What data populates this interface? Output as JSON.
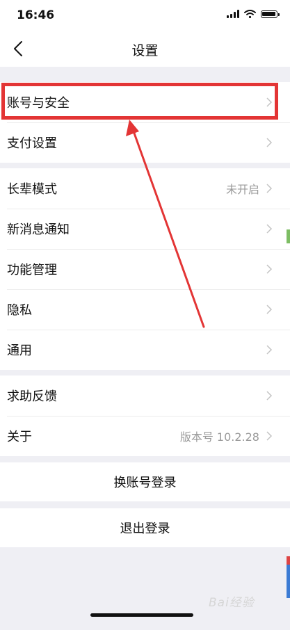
{
  "status_bar": {
    "time": "16:46"
  },
  "nav": {
    "title": "设置",
    "back_icon": "chevron-left-icon"
  },
  "groups": [
    {
      "items": [
        {
          "label": "账号与安全",
          "value": ""
        },
        {
          "label": "支付设置",
          "value": ""
        }
      ]
    },
    {
      "items": [
        {
          "label": "长辈模式",
          "value": "未开启"
        },
        {
          "label": "新消息通知",
          "value": ""
        },
        {
          "label": "功能管理",
          "value": ""
        },
        {
          "label": "隐私",
          "value": ""
        },
        {
          "label": "通用",
          "value": ""
        }
      ]
    },
    {
      "items": [
        {
          "label": "求助反馈",
          "value": ""
        },
        {
          "label": "关于",
          "value": "版本号 10.2.28"
        }
      ]
    }
  ],
  "actions": {
    "switch_account": "换账号登录",
    "logout": "退出登录"
  },
  "annotation": {
    "color": "#e33535",
    "highlighted_item": "账号与安全"
  },
  "watermark": "Bai经验",
  "colors": {
    "background": "#efeff4",
    "annotation_red": "#e33535"
  }
}
